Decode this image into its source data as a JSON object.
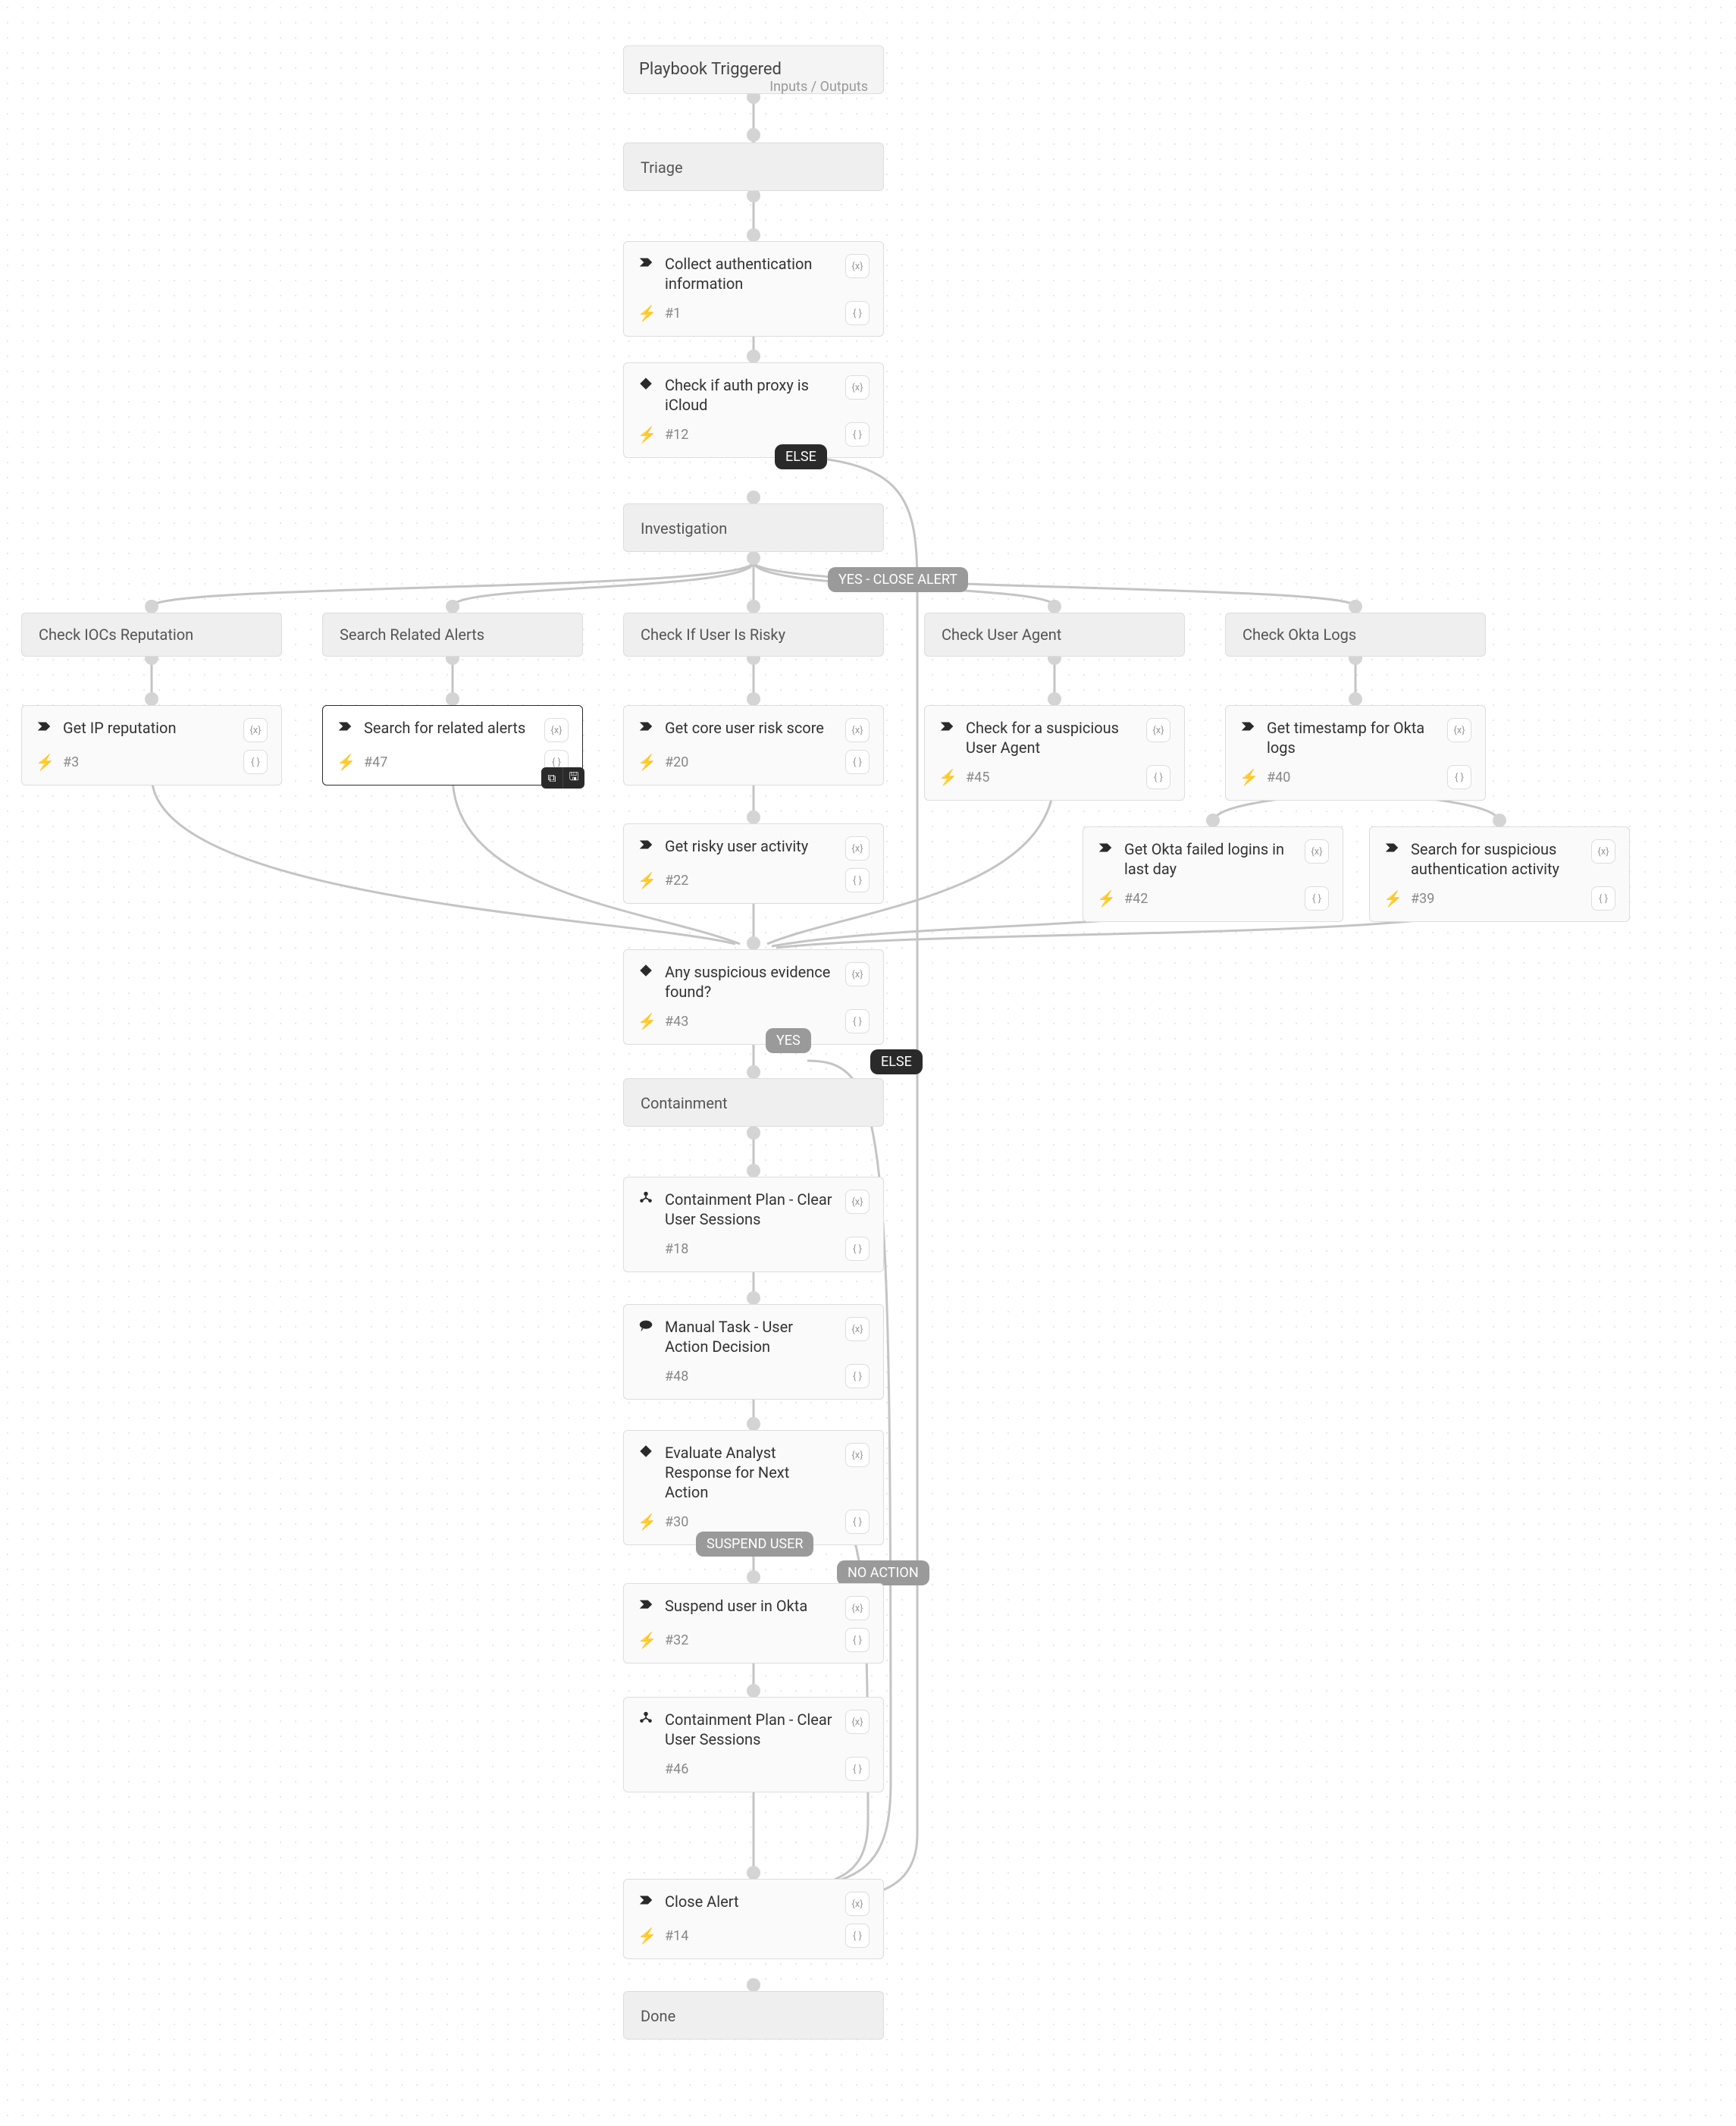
{
  "header": {
    "title": "Playbook Triggered",
    "meta": "Inputs / Outputs"
  },
  "sections": {
    "triage": "Triage",
    "investigation": "Investigation",
    "containment": "Containment",
    "done": "Done",
    "check_iocs": "Check IOCs Reputation",
    "search_related": "Search Related Alerts",
    "check_risky": "Check If User Is Risky",
    "check_ua": "Check User Agent",
    "check_okta": "Check Okta Logs"
  },
  "tasks": {
    "collect_auth": {
      "title": "Collect authentication information",
      "hash": "#1"
    },
    "check_icloud": {
      "title": "Check if auth proxy is iCloud",
      "hash": "#12"
    },
    "ip_rep": {
      "title": "Get IP reputation",
      "hash": "#3"
    },
    "search_alerts": {
      "title": "Search for related alerts",
      "hash": "#47"
    },
    "core_risk": {
      "title": "Get core user risk score",
      "hash": "#20"
    },
    "risky_activity": {
      "title": "Get risky user activity",
      "hash": "#22"
    },
    "sus_ua": {
      "title": "Check for a suspicious User Agent",
      "hash": "#45"
    },
    "okta_ts": {
      "title": "Get timestamp for Okta logs",
      "hash": "#40"
    },
    "okta_failed": {
      "title": "Get Okta failed logins in last day",
      "hash": "#42"
    },
    "okta_sus_auth": {
      "title": "Search for suspicious authentication activity",
      "hash": "#39"
    },
    "sus_found": {
      "title": "Any suspicious evidence found?",
      "hash": "#43"
    },
    "cp_clear1": {
      "title": "Containment Plan - Clear User Sessions",
      "hash": "#18"
    },
    "manual": {
      "title": "Manual Task - User Action Decision",
      "hash": "#48"
    },
    "eval_resp": {
      "title": "Evaluate Analyst Response for Next Action",
      "hash": "#30"
    },
    "suspend": {
      "title": "Suspend user in Okta",
      "hash": "#32"
    },
    "cp_clear2": {
      "title": "Containment Plan - Clear User Sessions",
      "hash": "#46"
    },
    "close": {
      "title": "Close Alert",
      "hash": "#14"
    }
  },
  "labels": {
    "else1": "ELSE",
    "else2": "ELSE",
    "yes": "YES",
    "yes_close": "YES - CLOSE ALERT",
    "suspend_user": "SUSPEND USER",
    "no_action": "NO ACTION"
  },
  "badges": {
    "b1": "{x}",
    "b2": "{ }"
  }
}
